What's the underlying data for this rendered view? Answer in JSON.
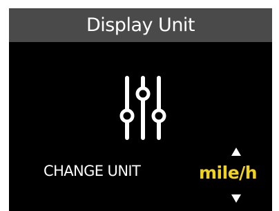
{
  "header": {
    "title": "Display Unit"
  },
  "settings_icon": {
    "name": "sliders-icon"
  },
  "option": {
    "label": "CHANGE UNIT",
    "value": "mile/h"
  },
  "colors": {
    "screen_background": "#000000",
    "title_bar": "#4a4a4a",
    "text": "#ffffff",
    "value_accent": "#f2d31b"
  }
}
